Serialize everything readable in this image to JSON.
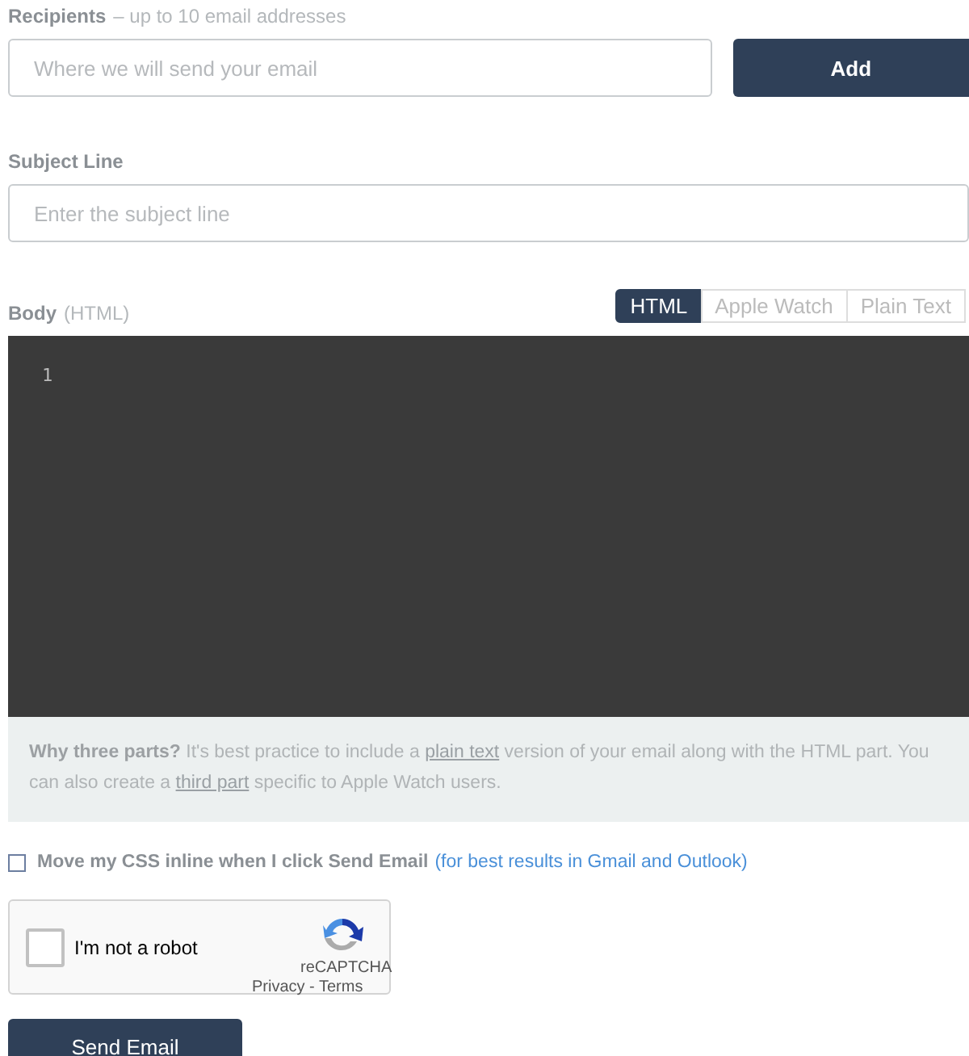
{
  "recipients": {
    "label": "Recipients",
    "hint": "– up to 10 email addresses",
    "placeholder": "Where we will send your email",
    "button": "Add"
  },
  "subject": {
    "label": "Subject Line",
    "placeholder": "Enter the subject line"
  },
  "body": {
    "label": "Body",
    "format": "(HTML)",
    "tabs": [
      {
        "label": "HTML",
        "selected": true
      },
      {
        "label": "Apple Watch",
        "selected": false
      },
      {
        "label": "Plain Text",
        "selected": false
      }
    ],
    "line_numbers": [
      "1"
    ],
    "note": [
      {
        "kind": "text",
        "text": "**Why three parts?** It's best practice to include a "
      },
      {
        "kind": "link",
        "text": "plain text"
      },
      {
        "kind": "text",
        "text": " version of your email along with the HTML part. You can also create a "
      },
      {
        "kind": "link",
        "text": "third part"
      },
      {
        "kind": "text",
        "text": " specific to Apple Watch users."
      }
    ]
  },
  "inline_css": {
    "checked": false,
    "label": "Move my CSS inline when I click Send Email",
    "note": "(for best results in Gmail and Outlook)"
  },
  "captcha": {
    "checked": false,
    "label": "I'm not a robot",
    "brand": "reCAPTCHA",
    "links": "Privacy - Terms"
  },
  "send_button": "Send Email"
}
